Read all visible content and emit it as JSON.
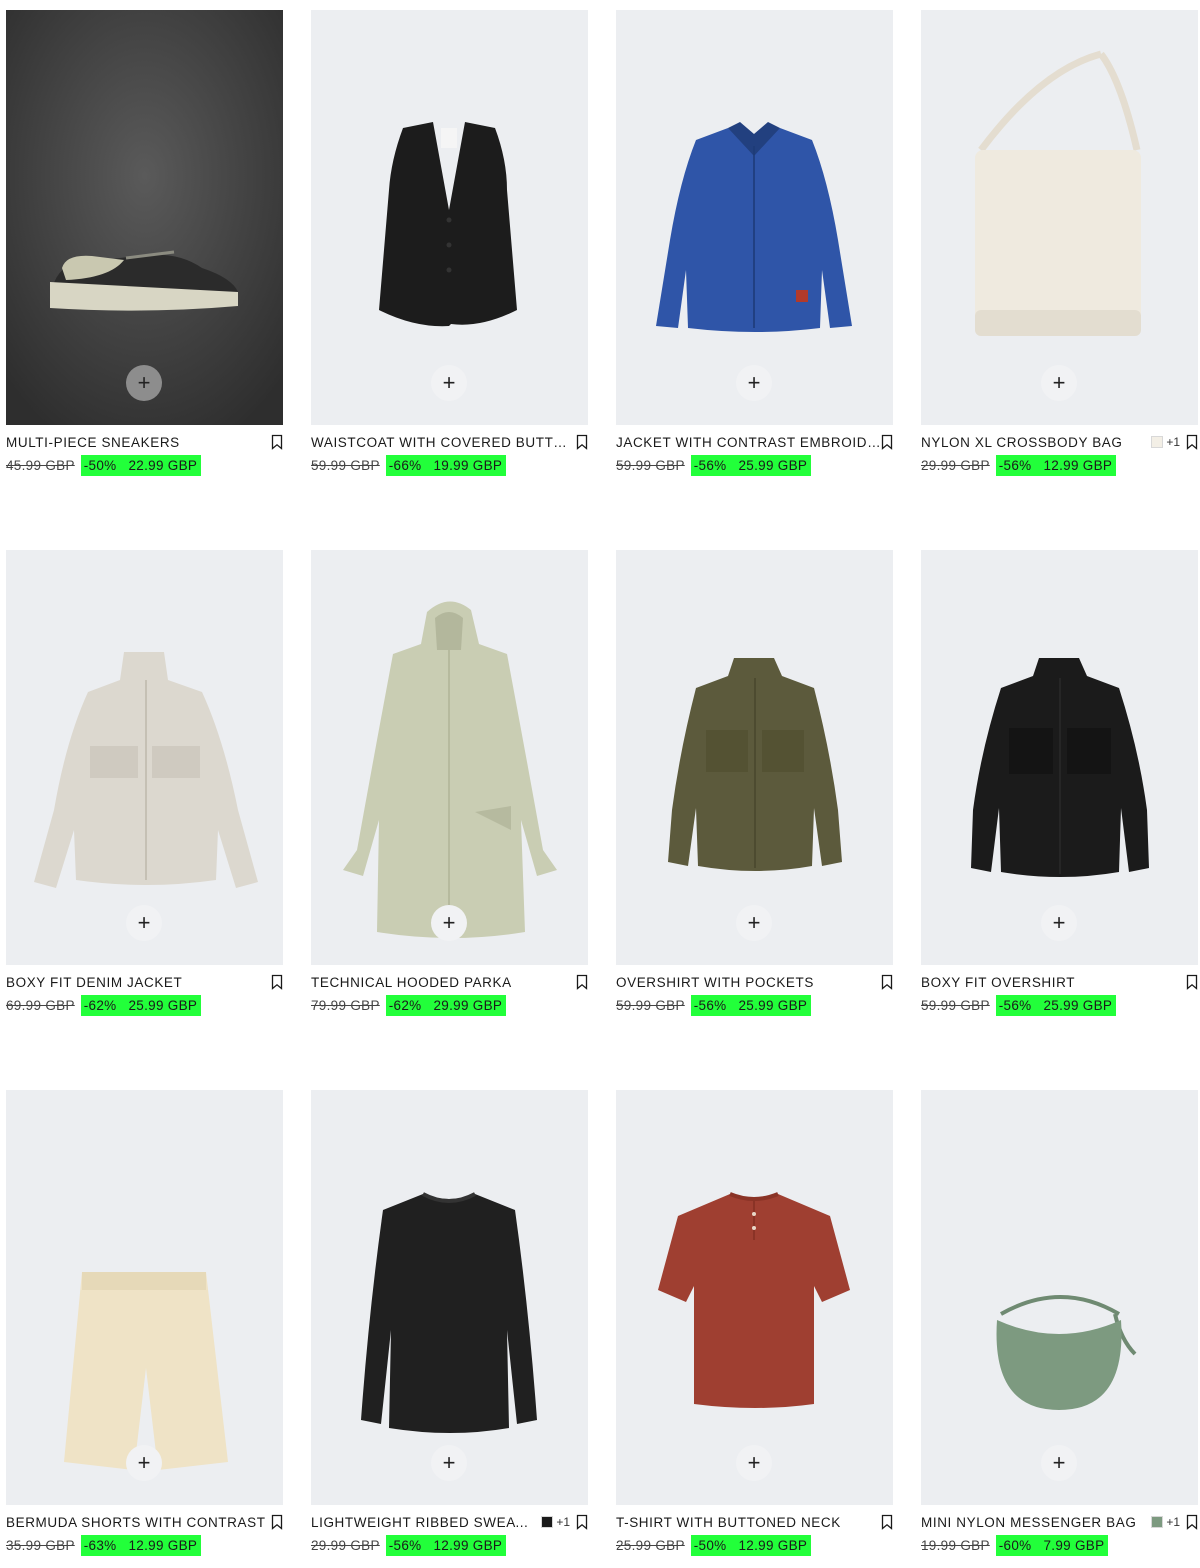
{
  "colors": {
    "discount_bg": "#22ff3a",
    "card_bg": "#ecedf0",
    "text": "#1a1a1a"
  },
  "icons": {
    "add": "plus-icon",
    "save": "bookmark-icon"
  },
  "add_label": "+",
  "products": [
    {
      "name": "MULTI-PIECE SNEAKERS",
      "old_price": "45.99 GBP",
      "discount": "-50%",
      "price": "22.99 GBP",
      "more": "",
      "swatch": "",
      "image": "sneaker"
    },
    {
      "name": "WAISTCOAT WITH COVERED BUTTONS",
      "old_price": "59.99 GBP",
      "discount": "-66%",
      "price": "19.99 GBP",
      "more": "",
      "swatch": "",
      "image": "waistcoat"
    },
    {
      "name": "JACKET WITH CONTRAST EMBROIDERY",
      "old_price": "59.99 GBP",
      "discount": "-56%",
      "price": "25.99 GBP",
      "more": "",
      "swatch": "",
      "image": "blue-jacket"
    },
    {
      "name": "NYLON XL CROSSBODY BAG",
      "old_price": "29.99 GBP",
      "discount": "-56%",
      "price": "12.99 GBP",
      "more": "+1",
      "swatch": "#f3efe6",
      "image": "cream-bag"
    },
    {
      "name": "BOXY FIT DENIM JACKET",
      "old_price": "69.99 GBP",
      "discount": "-62%",
      "price": "25.99 GBP",
      "more": "",
      "swatch": "",
      "image": "denim-jacket"
    },
    {
      "name": "TECHNICAL HOODED PARKA",
      "old_price": "79.99 GBP",
      "discount": "-62%",
      "price": "29.99 GBP",
      "more": "",
      "swatch": "",
      "image": "parka"
    },
    {
      "name": "OVERSHIRT WITH POCKETS",
      "old_price": "59.99 GBP",
      "discount": "-56%",
      "price": "25.99 GBP",
      "more": "",
      "swatch": "",
      "image": "olive-overshirt"
    },
    {
      "name": "BOXY FIT OVERSHIRT",
      "old_price": "59.99 GBP",
      "discount": "-56%",
      "price": "25.99 GBP",
      "more": "",
      "swatch": "",
      "image": "black-overshirt"
    },
    {
      "name": "BERMUDA SHORTS WITH CONTRAST",
      "old_price": "35.99 GBP",
      "discount": "-63%",
      "price": "12.99 GBP",
      "more": "",
      "swatch": "",
      "image": "shorts"
    },
    {
      "name": "LIGHTWEIGHT RIBBED SWEATER",
      "old_price": "29.99 GBP",
      "discount": "-56%",
      "price": "12.99 GBP",
      "more": "+1",
      "swatch": "#1a1a1a",
      "image": "sweater"
    },
    {
      "name": "T-SHIRT WITH BUTTONED NECK",
      "old_price": "25.99 GBP",
      "discount": "-50%",
      "price": "12.99 GBP",
      "more": "",
      "swatch": "",
      "image": "tshirt"
    },
    {
      "name": "MINI NYLON MESSENGER BAG",
      "old_price": "19.99 GBP",
      "discount": "-60%",
      "price": "7.99 GBP",
      "more": "+1",
      "swatch": "#7d9a80",
      "image": "green-bag"
    }
  ]
}
